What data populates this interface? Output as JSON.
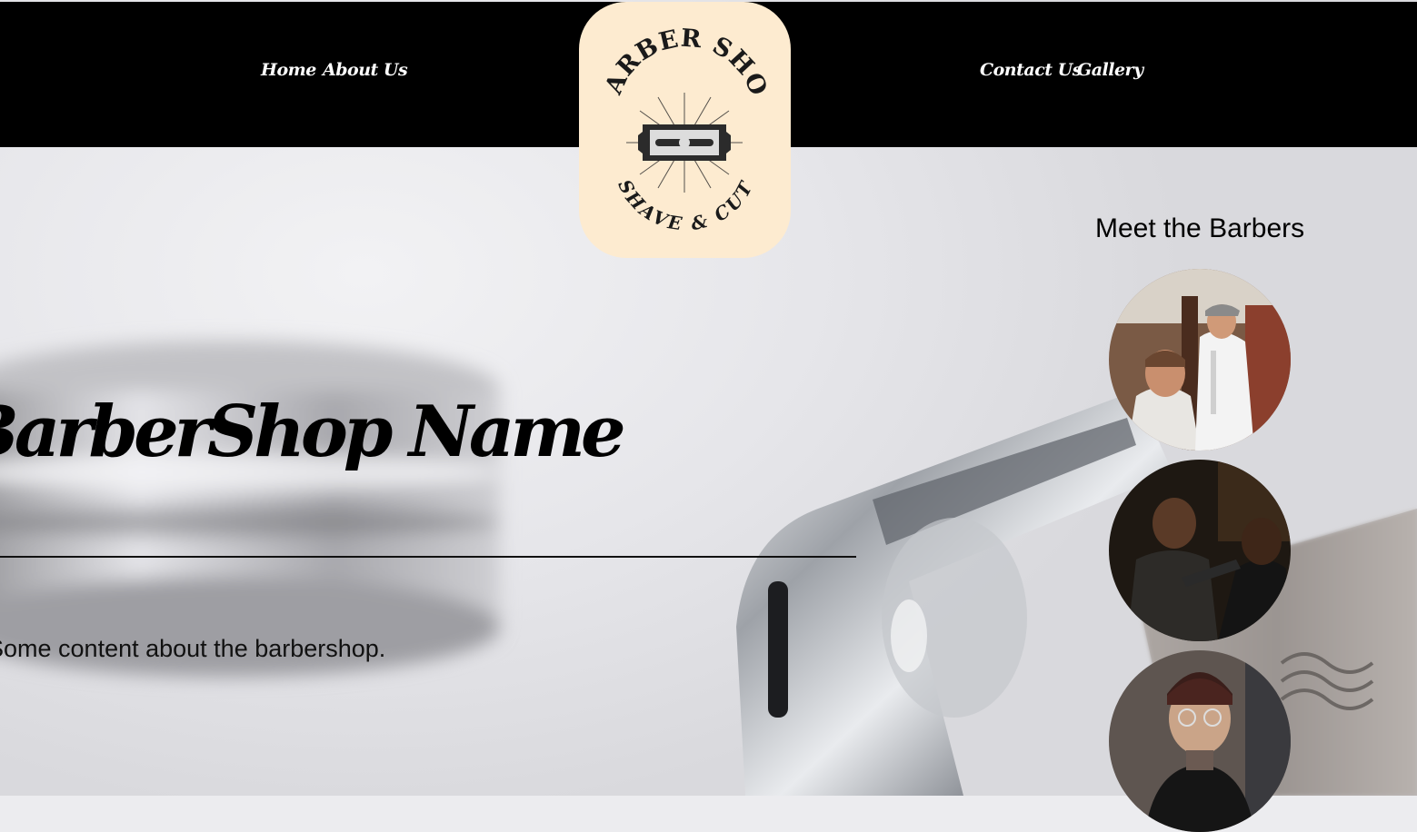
{
  "nav": {
    "left": [
      "Home",
      "About Us"
    ],
    "right": [
      "Contact Us",
      "Gallery"
    ]
  },
  "logo": {
    "top_text": "BARBER SHOP",
    "bottom_text": "SHAVE & CUT"
  },
  "hero": {
    "title": "BarberShop Name",
    "text": "Some content about the barbershop."
  },
  "barbers": {
    "title": "Meet the Barbers",
    "items": [
      "barber-photo-1",
      "barber-photo-2",
      "barber-photo-3"
    ]
  },
  "colors": {
    "header_bg": "#000000",
    "logo_bg": "#fdebd0",
    "nav_text": "#ffffff"
  }
}
